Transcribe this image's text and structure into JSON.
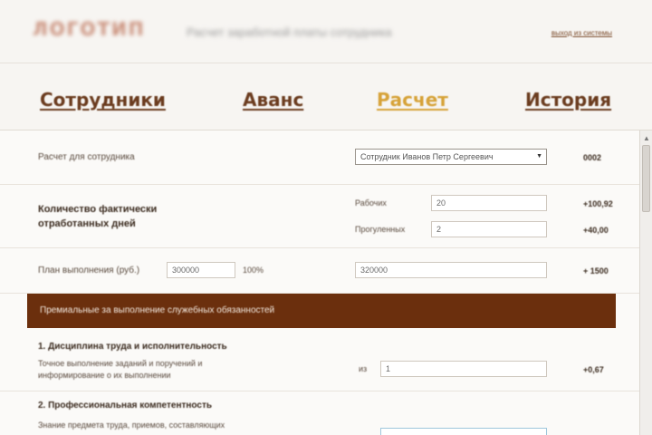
{
  "header": {
    "logo_text": "ЛОГОТИП",
    "tagline": "Расчет заработной платы сотрудника",
    "top_link": "выход из системы"
  },
  "nav": {
    "items": [
      {
        "label": "Сотрудники"
      },
      {
        "label": "Аванс"
      },
      {
        "label": "Расчет",
        "active": true
      },
      {
        "label": "История"
      }
    ]
  },
  "form": {
    "employee_row": {
      "label": "Расчет для сотрудника",
      "select_value": "Сотрудник Иванов Петр Сергеевич",
      "value": "0002"
    },
    "days_row": {
      "label_line1": "Количество фактически",
      "label_line2": "отработанных дней",
      "worked_label": "Рабочих",
      "worked_value": "20",
      "worked_total": "+100,92",
      "missed_label": "Прогуленных",
      "missed_value": "2",
      "missed_total": "+40,00"
    },
    "plan_row": {
      "label": "План выполнения (руб.)",
      "plan_value": "300000",
      "percent_label": "100%",
      "fact_value": "320000",
      "value": "+ 1500"
    },
    "section": {
      "title": "Премиальные за выполнение служебных обязанностей"
    },
    "criteria": [
      {
        "title": "1. Дисциплина труда и исполнительность",
        "desc_line1": "Точное выполнение заданий и поручений и",
        "desc_line2": "информирование о их выполнении",
        "prefix": "из",
        "input_value": "1",
        "value": "+0,67"
      },
      {
        "title": "2. Профессиональная компетентность",
        "desc_line1": "Знание предмета труда, приемов, составляющих",
        "input_value": ""
      }
    ]
  },
  "colors": {
    "brand_brown": "#6b2f0d",
    "nav_link": "#6b3c1f",
    "nav_active": "#d6a238"
  }
}
